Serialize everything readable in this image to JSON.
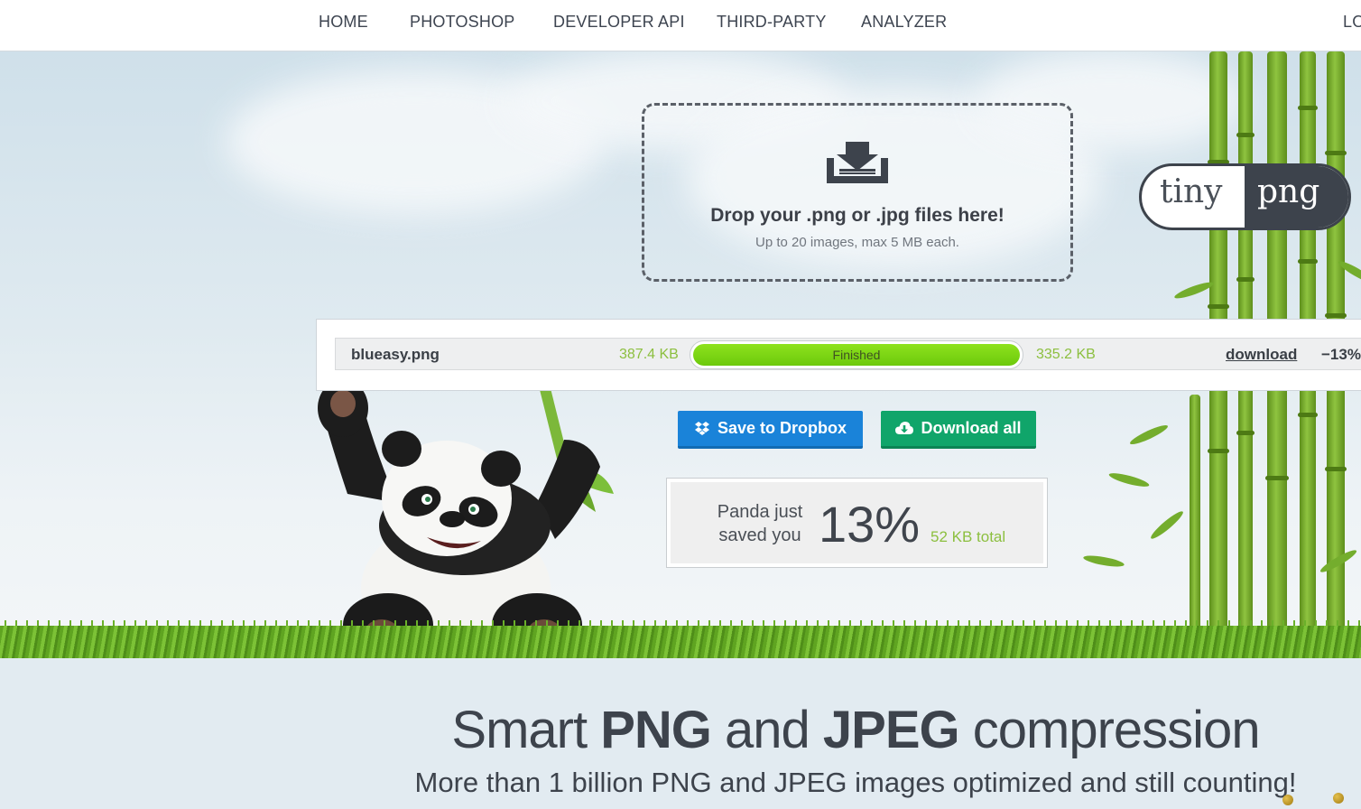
{
  "nav": {
    "items": [
      "HOME",
      "PHOTOSHOP",
      "DEVELOPER API",
      "THIRD-PARTY",
      "ANALYZER"
    ],
    "truncated_item": "LO"
  },
  "dropzone": {
    "title": "Drop your .png or .jpg files here!",
    "subtitle": "Up to 20 images, max 5 MB each.",
    "icon": "download-tray-icon"
  },
  "logo": {
    "left": "tiny",
    "right": "png"
  },
  "result": {
    "filename": "blueasy.png",
    "original_size": "387.4 KB",
    "status": "Finished",
    "progress": 1.0,
    "new_size": "335.2 KB",
    "download_label": "download",
    "percent": "−13%"
  },
  "buttons": {
    "dropbox": "Save to Dropbox",
    "download_all": "Download all"
  },
  "saved": {
    "line1": "Panda just",
    "line2": "saved you",
    "percent": "13%",
    "total": "52 KB total"
  },
  "bottom": {
    "headline_parts": [
      "Smart ",
      "PNG",
      " and ",
      "JPEG",
      " compression"
    ],
    "subheadline": "More than 1 billion PNG and JPEG images optimized and still counting!"
  },
  "colors": {
    "accent_green": "#8cbf3f",
    "dropbox_blue": "#1a83d9",
    "download_green": "#10a56a",
    "text_dark": "#3d434c"
  }
}
